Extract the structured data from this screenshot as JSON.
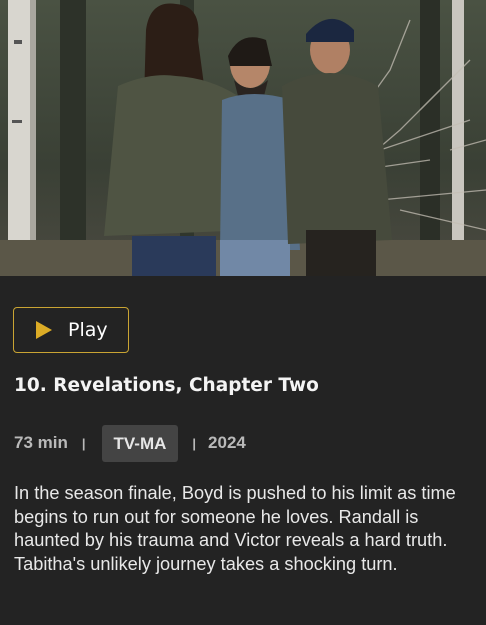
{
  "hero": {
    "image_alt": "Three people walking through a forest of bare birch trees"
  },
  "actions": {
    "play_label": "Play",
    "play_icon": "play-triangle-icon",
    "accent_color": "#dcac26"
  },
  "episode": {
    "title": "10. Revelations, Chapter Two",
    "duration": "73 min",
    "separator": "|",
    "rating": "TV-MA",
    "year": "2024",
    "synopsis": "In the season finale, Boyd is pushed to his limit as time begins to run out for someone he loves. Randall is haunted by his trauma and Victor reveals a hard truth. Tabitha's unlikely journey takes a shocking turn."
  }
}
